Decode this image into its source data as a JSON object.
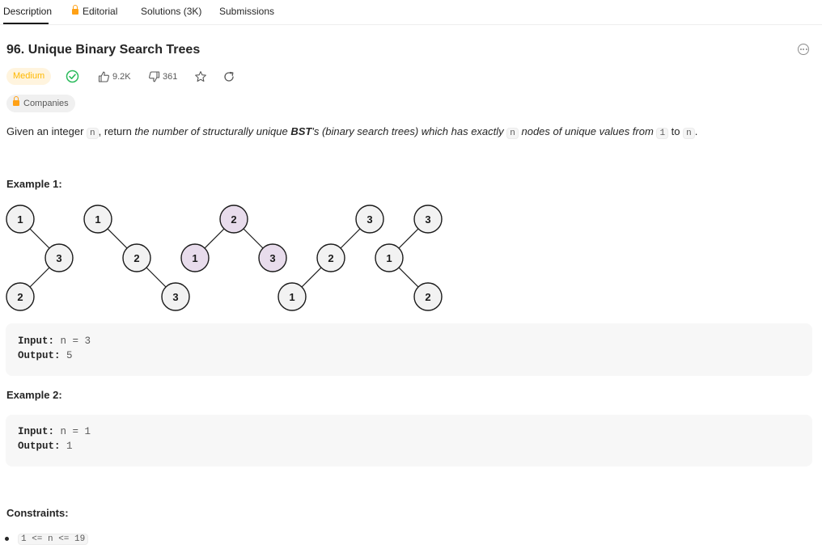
{
  "tabs": [
    {
      "label": "Description",
      "locked": false,
      "active": true
    },
    {
      "label": "Editorial",
      "locked": true,
      "active": false
    },
    {
      "label": "Solutions (3K)",
      "locked": false,
      "active": false
    },
    {
      "label": "Submissions",
      "locked": false,
      "active": false
    }
  ],
  "problem": {
    "title": "96. Unique Binary Search Trees",
    "difficulty": "Medium",
    "likes": "9.2K",
    "dislikes": "361",
    "companies_label": "Companies"
  },
  "description": {
    "p1": "Given an integer ",
    "code_n": "n",
    "p2": ", return ",
    "em1": "the number of structurally unique ",
    "bold": "BST",
    "em2": "'s (binary search trees) which has exactly ",
    "em3": " nodes of unique values from ",
    "code_1": "1",
    "to": " to ",
    "end": "."
  },
  "examples": [
    {
      "heading": "Example 1:",
      "input_label": "Input:",
      "input_value": " n = 3",
      "output_label": "Output:",
      "output_value": " 5"
    },
    {
      "heading": "Example 2:",
      "input_label": "Input:",
      "input_value": " n = 1",
      "output_label": "Output:",
      "output_value": " 1"
    }
  ],
  "trees": {
    "node_fill": "#f2f2f2",
    "highlight_fill": "#e8dcec",
    "nodes": [
      "1",
      "3",
      "2",
      "1",
      "2",
      "3",
      "2",
      "1",
      "3",
      "3",
      "2",
      "1",
      "3",
      "1",
      "2"
    ]
  },
  "constraints": {
    "heading": "Constraints:",
    "items": [
      "1 <= n <= 19"
    ]
  },
  "colors": {
    "accent_orange": "#ffa116",
    "medium_text": "#ffb800",
    "medium_bg": "#fff4de",
    "solved_green": "#2cbb5d"
  }
}
